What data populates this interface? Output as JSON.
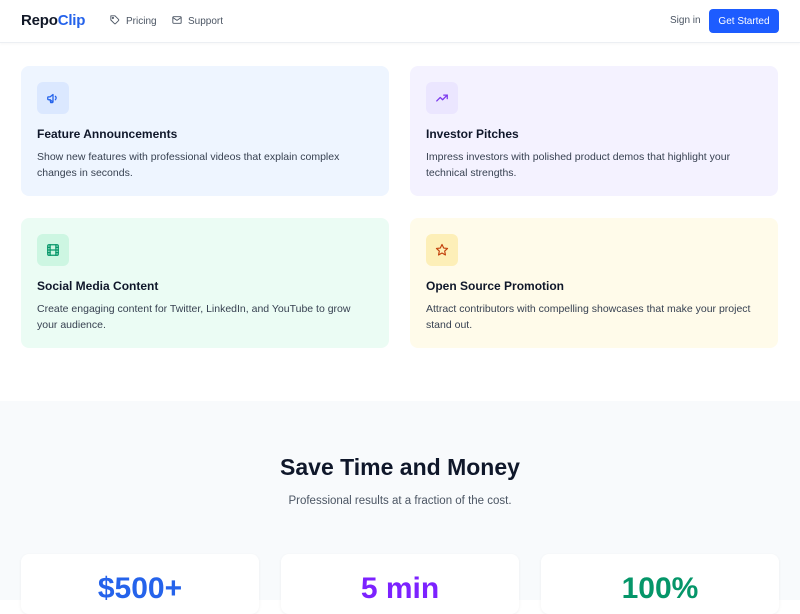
{
  "nav": {
    "logo_part1": "Repo",
    "logo_part2": "Clip",
    "links": [
      {
        "label": "Pricing",
        "icon": "tag-icon"
      },
      {
        "label": "Support",
        "icon": "mail-icon"
      }
    ],
    "sign_in": "Sign in",
    "get_started": "Get Started"
  },
  "use_cases": [
    {
      "title": "Feature Announcements",
      "description": "Show new features with professional videos that explain complex changes in seconds.",
      "icon": "megaphone-icon",
      "bg": "#eef5ff",
      "icon_bg": "#dbe8ff",
      "icon_color": "#2563eb"
    },
    {
      "title": "Investor Pitches",
      "description": "Impress investors with polished product demos that highlight your technical strengths.",
      "icon": "trending-up-icon",
      "bg": "#f4f2ff",
      "icon_bg": "#ebe6ff",
      "icon_color": "#7c3aed"
    },
    {
      "title": "Social Media Content",
      "description": "Create engaging content for Twitter, LinkedIn, and YouTube to grow your audience.",
      "icon": "film-icon",
      "bg": "#ebfcf4",
      "icon_bg": "#cdf6e2",
      "icon_color": "#059669"
    },
    {
      "title": "Open Source Promotion",
      "description": "Attract contributors with compelling showcases that make your project stand out.",
      "icon": "star-icon",
      "bg": "#fffbea",
      "icon_bg": "#fdefb8",
      "icon_color": "#c2410c"
    }
  ],
  "savings": {
    "title": "Save Time and Money",
    "subtitle": "Professional results at a fraction of the cost.",
    "stats": [
      {
        "value": "$500+",
        "color": "#2563eb"
      },
      {
        "value": "5 min",
        "color": "#7c22ff"
      },
      {
        "value": "100%",
        "color": "#059669"
      }
    ]
  },
  "colors": {
    "accent": "#1d5cff",
    "section_bg": "#f8fafc"
  }
}
